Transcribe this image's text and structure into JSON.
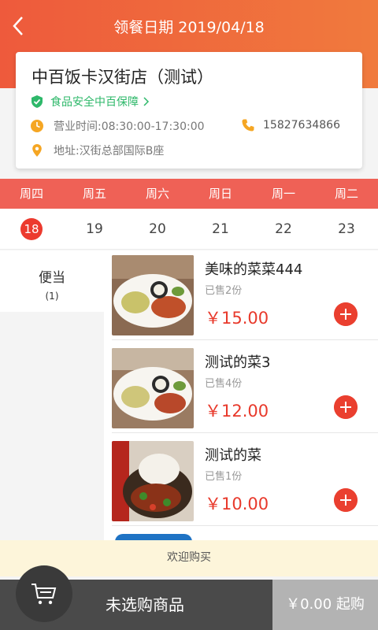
{
  "header": {
    "title": "领餐日期 2019/04/18"
  },
  "store": {
    "name": "中百饭卡汉街店（测试）",
    "safety": "食品安全中百保障",
    "hours": "营业时间:08:30:00-17:30:00",
    "phone": "15827634866",
    "address": "地址:汉街总部国际B座"
  },
  "weekdays": [
    "周四",
    "周五",
    "周六",
    "周日",
    "周一",
    "周二"
  ],
  "dates": [
    "18",
    "19",
    "20",
    "21",
    "22",
    "23"
  ],
  "selected_date_index": 0,
  "category": {
    "name": "便当",
    "count": "(1)"
  },
  "dishes": [
    {
      "name": "美味的菜菜444",
      "sold": "已售2份",
      "price": "￥15.00"
    },
    {
      "name": "测试的菜3",
      "sold": "已售4份",
      "price": "￥12.00"
    },
    {
      "name": "测试的菜",
      "sold": "已售1份",
      "price": "￥10.00"
    }
  ],
  "welcome": "欢迎购买",
  "cart": {
    "empty_label": "未选购商品",
    "checkout_label": "￥0.00 起购"
  },
  "colors": {
    "accent": "#ec3a2e",
    "header": "#ee5a3c",
    "safety": "#2eb86a",
    "icon_yellow": "#f5a623"
  }
}
